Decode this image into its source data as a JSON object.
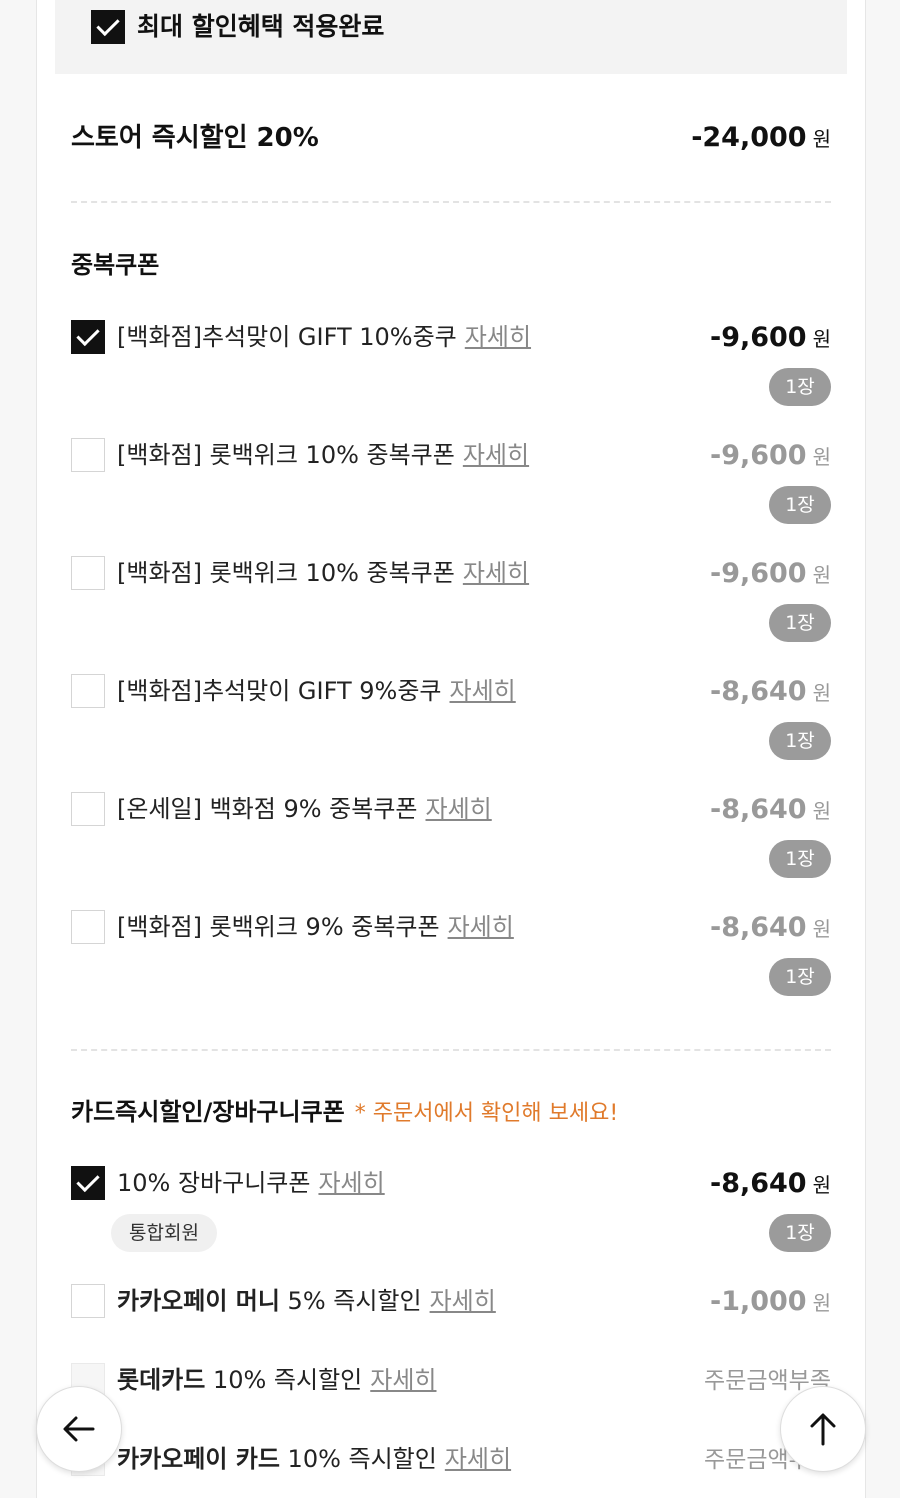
{
  "banner": {
    "label": "최대 할인혜택 적용완료"
  },
  "store_discount": {
    "label": "스토어 즉시할인 20%",
    "amount": "-24,000",
    "unit": "원"
  },
  "duplicate_section": {
    "title": "중복쿠폰",
    "coupons": [
      {
        "name": "[백화점]추석맞이 GIFT 10%중쿠",
        "detail": "자세히",
        "amount": "-9,600",
        "unit": "원",
        "count": "1장",
        "checked": true
      },
      {
        "name": "[백화점] 롯백위크 10% 중복쿠폰",
        "detail": "자세히",
        "amount": "-9,600",
        "unit": "원",
        "count": "1장",
        "checked": false
      },
      {
        "name": "[백화점] 롯백위크 10% 중복쿠폰",
        "detail": "자세히",
        "amount": "-9,600",
        "unit": "원",
        "count": "1장",
        "checked": false
      },
      {
        "name": "[백화점]추석맞이 GIFT 9%중쿠",
        "detail": "자세히",
        "amount": "-8,640",
        "unit": "원",
        "count": "1장",
        "checked": false
      },
      {
        "name": "[온세일] 백화점 9% 중복쿠폰",
        "detail": "자세히",
        "amount": "-8,640",
        "unit": "원",
        "count": "1장",
        "checked": false
      },
      {
        "name": "[백화점] 롯백위크 9% 중복쿠폰",
        "detail": "자세히",
        "amount": "-8,640",
        "unit": "원",
        "count": "1장",
        "checked": false
      }
    ]
  },
  "card_section": {
    "title": "카드즉시할인/장바구니쿠폰",
    "note": "* 주문서에서 확인해 보세요!",
    "items": [
      {
        "name": "10% 장바구니쿠폰",
        "detail": "자세히",
        "amount": "-8,640",
        "unit": "원",
        "count": "1장",
        "tag": "통합회원",
        "checked": true
      },
      {
        "brand": "카카오페이 머니",
        "name": " 5% 즉시할인",
        "detail": "자세히",
        "amount": "-1,000",
        "unit": "원",
        "checked": false
      },
      {
        "brand": "롯데카드",
        "name": " 10% 즉시할인",
        "detail": "자세히",
        "status": "주문금액부족",
        "checked": false
      },
      {
        "brand": "카카오페이 카드",
        "name": " 10% 즉시할인",
        "detail": "자세히",
        "status": "주문금액부족",
        "checked": false
      }
    ]
  },
  "icons": {
    "back": "arrow-left-icon",
    "top": "arrow-up-icon"
  }
}
